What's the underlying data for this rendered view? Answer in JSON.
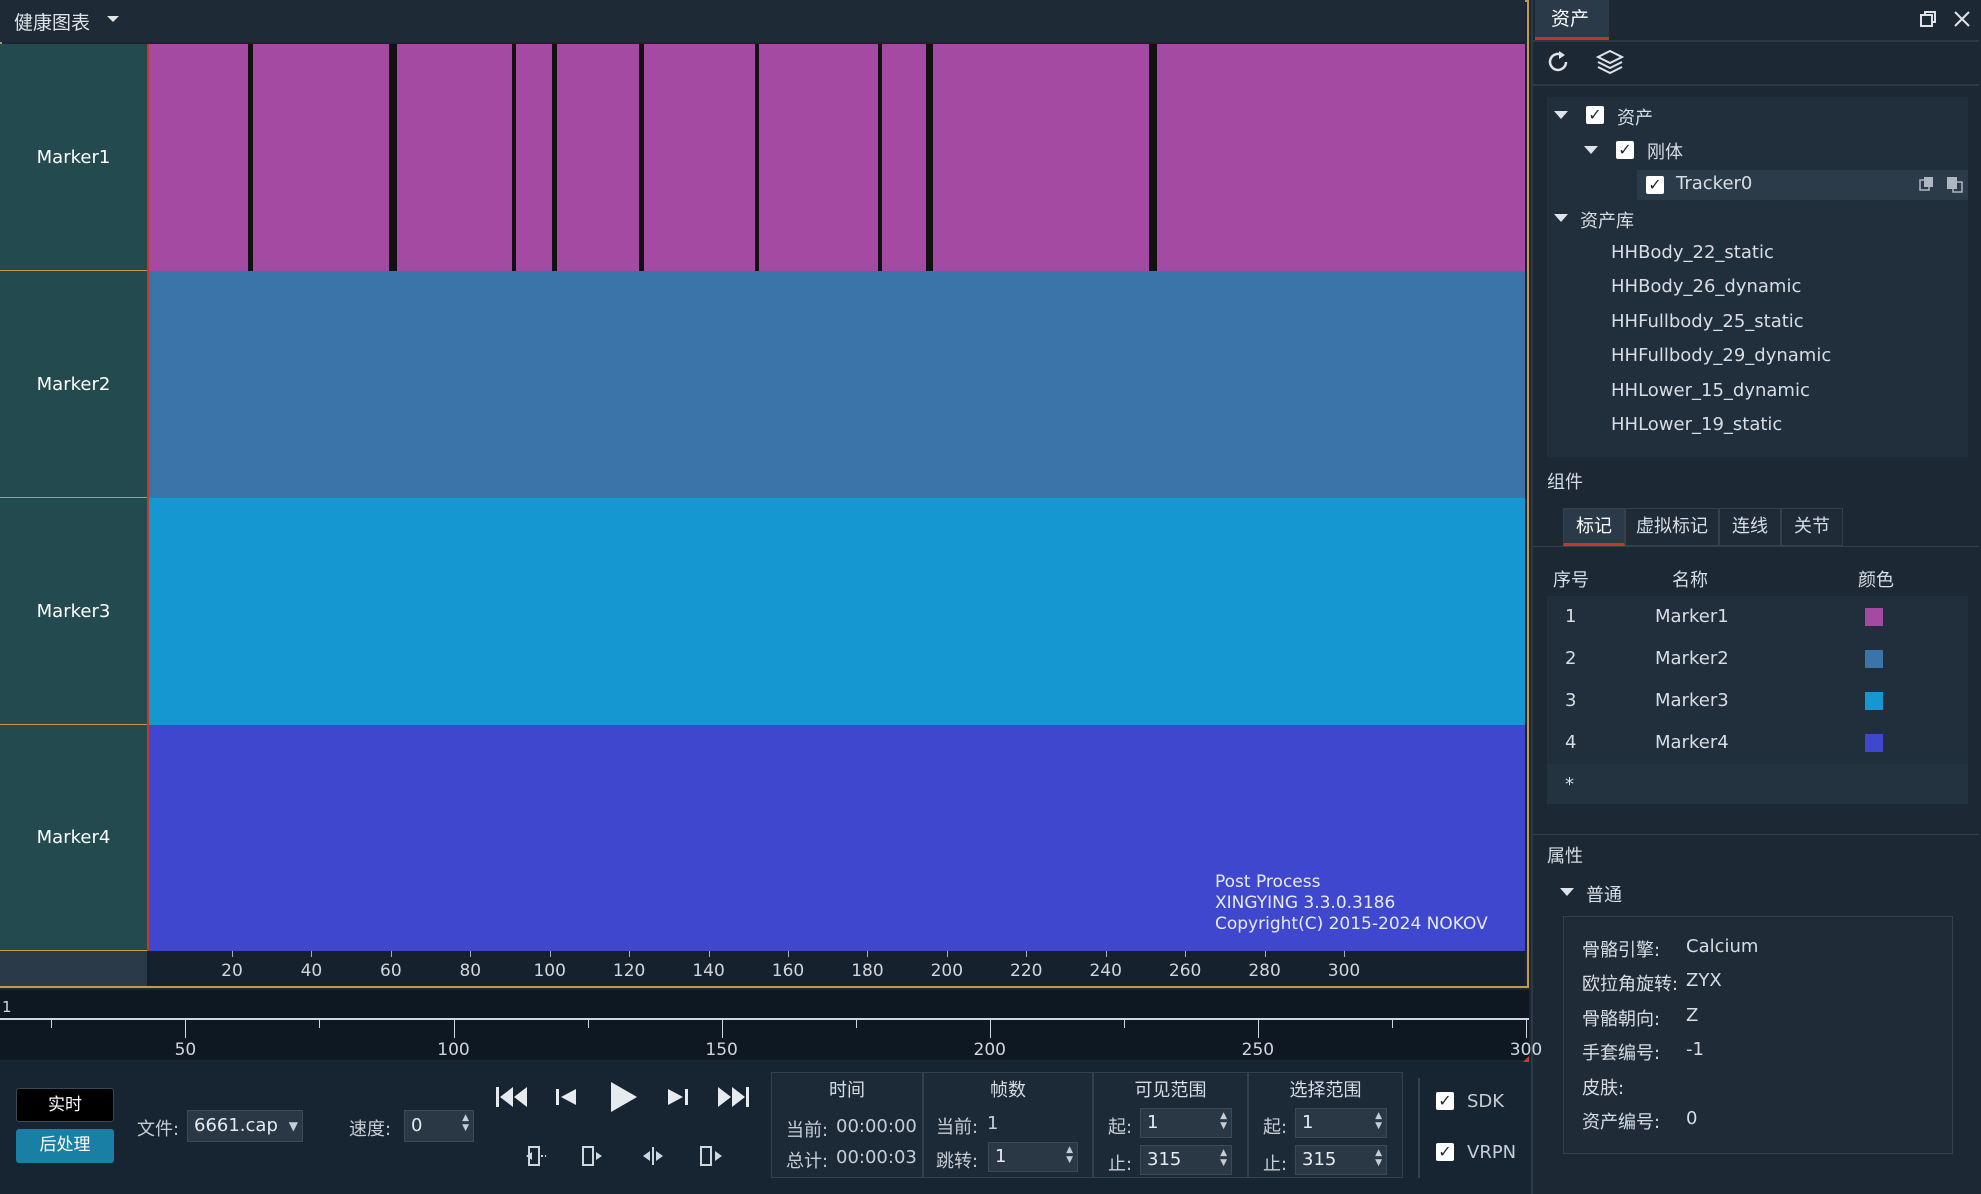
{
  "health_panel": {
    "title": "健康图表",
    "markers": [
      {
        "label": "Marker1",
        "color": "#a44aa2"
      },
      {
        "label": "Marker2",
        "color": "#3a74a8"
      },
      {
        "label": "Marker3",
        "color": "#1597d1"
      },
      {
        "label": "Marker4",
        "color": "#3f47cf"
      }
    ],
    "axis_ticks": [
      "20",
      "40",
      "60",
      "80",
      "100",
      "120",
      "140",
      "160",
      "180",
      "200",
      "220",
      "240",
      "260",
      "280",
      "300"
    ],
    "watermark": {
      "line1": "Post Process",
      "line2": "XINGYING 3.3.0.3186",
      "line3": "Copyright(C) 2015-2024 NOKOV"
    }
  },
  "timeline": {
    "start": "1",
    "labels": [
      "50",
      "100",
      "150",
      "200",
      "250",
      "300"
    ]
  },
  "controls": {
    "mode_live": "实时",
    "mode_post": "后处理",
    "file_label": "文件:",
    "file_value": "6661.cap",
    "speed_label": "速度:",
    "speed_value": "0",
    "time": {
      "header": "时间",
      "current_label": "当前:",
      "current_value": "00:00:00",
      "total_label": "总计:",
      "total_value": "00:00:03"
    },
    "frames": {
      "header": "帧数",
      "current_label": "当前:",
      "current_value": "1",
      "jump_label": "跳转:",
      "jump_value": "1"
    },
    "visible_range": {
      "header": "可见范围",
      "start_label": "起:",
      "start_value": "1",
      "end_label": "止:",
      "end_value": "315"
    },
    "select_range": {
      "header": "选择范围",
      "start_label": "起:",
      "start_value": "1",
      "end_label": "止:",
      "end_value": "315"
    },
    "sdk_label": "SDK",
    "vrpn_label": "VRPN"
  },
  "right_panel": {
    "tab": "资产",
    "tree": {
      "assets": "资产",
      "rigid": "刚体",
      "tracker": "Tracker0",
      "library": "资产库",
      "library_items": [
        "HHBody_22_static",
        "HHBody_26_dynamic",
        "HHFullbody_25_static",
        "HHFullbody_29_dynamic",
        "HHLower_15_dynamic",
        "HHLower_19_static"
      ]
    },
    "components": {
      "title": "组件",
      "tabs": [
        "标记",
        "虚拟标记",
        "连线",
        "关节"
      ],
      "columns": {
        "index": "序号",
        "name": "名称",
        "color": "颜色"
      },
      "rows": [
        {
          "index": "1",
          "name": "Marker1",
          "color": "#a44aa2"
        },
        {
          "index": "2",
          "name": "Marker2",
          "color": "#3a74a8"
        },
        {
          "index": "3",
          "name": "Marker3",
          "color": "#1597d1"
        },
        {
          "index": "4",
          "name": "Marker4",
          "color": "#3f47cf"
        }
      ],
      "new_row": "*"
    },
    "properties": {
      "title": "属性",
      "section": "普通",
      "items": [
        {
          "key": "骨骼引擎:",
          "value": "Calcium"
        },
        {
          "key": "欧拉角旋转:",
          "value": "ZYX"
        },
        {
          "key": "骨骼朝向:",
          "value": "Z"
        },
        {
          "key": "手套编号:",
          "value": "-1"
        },
        {
          "key": "皮肤:",
          "value": ""
        },
        {
          "key": "资产编号:",
          "value": "0"
        }
      ]
    }
  }
}
